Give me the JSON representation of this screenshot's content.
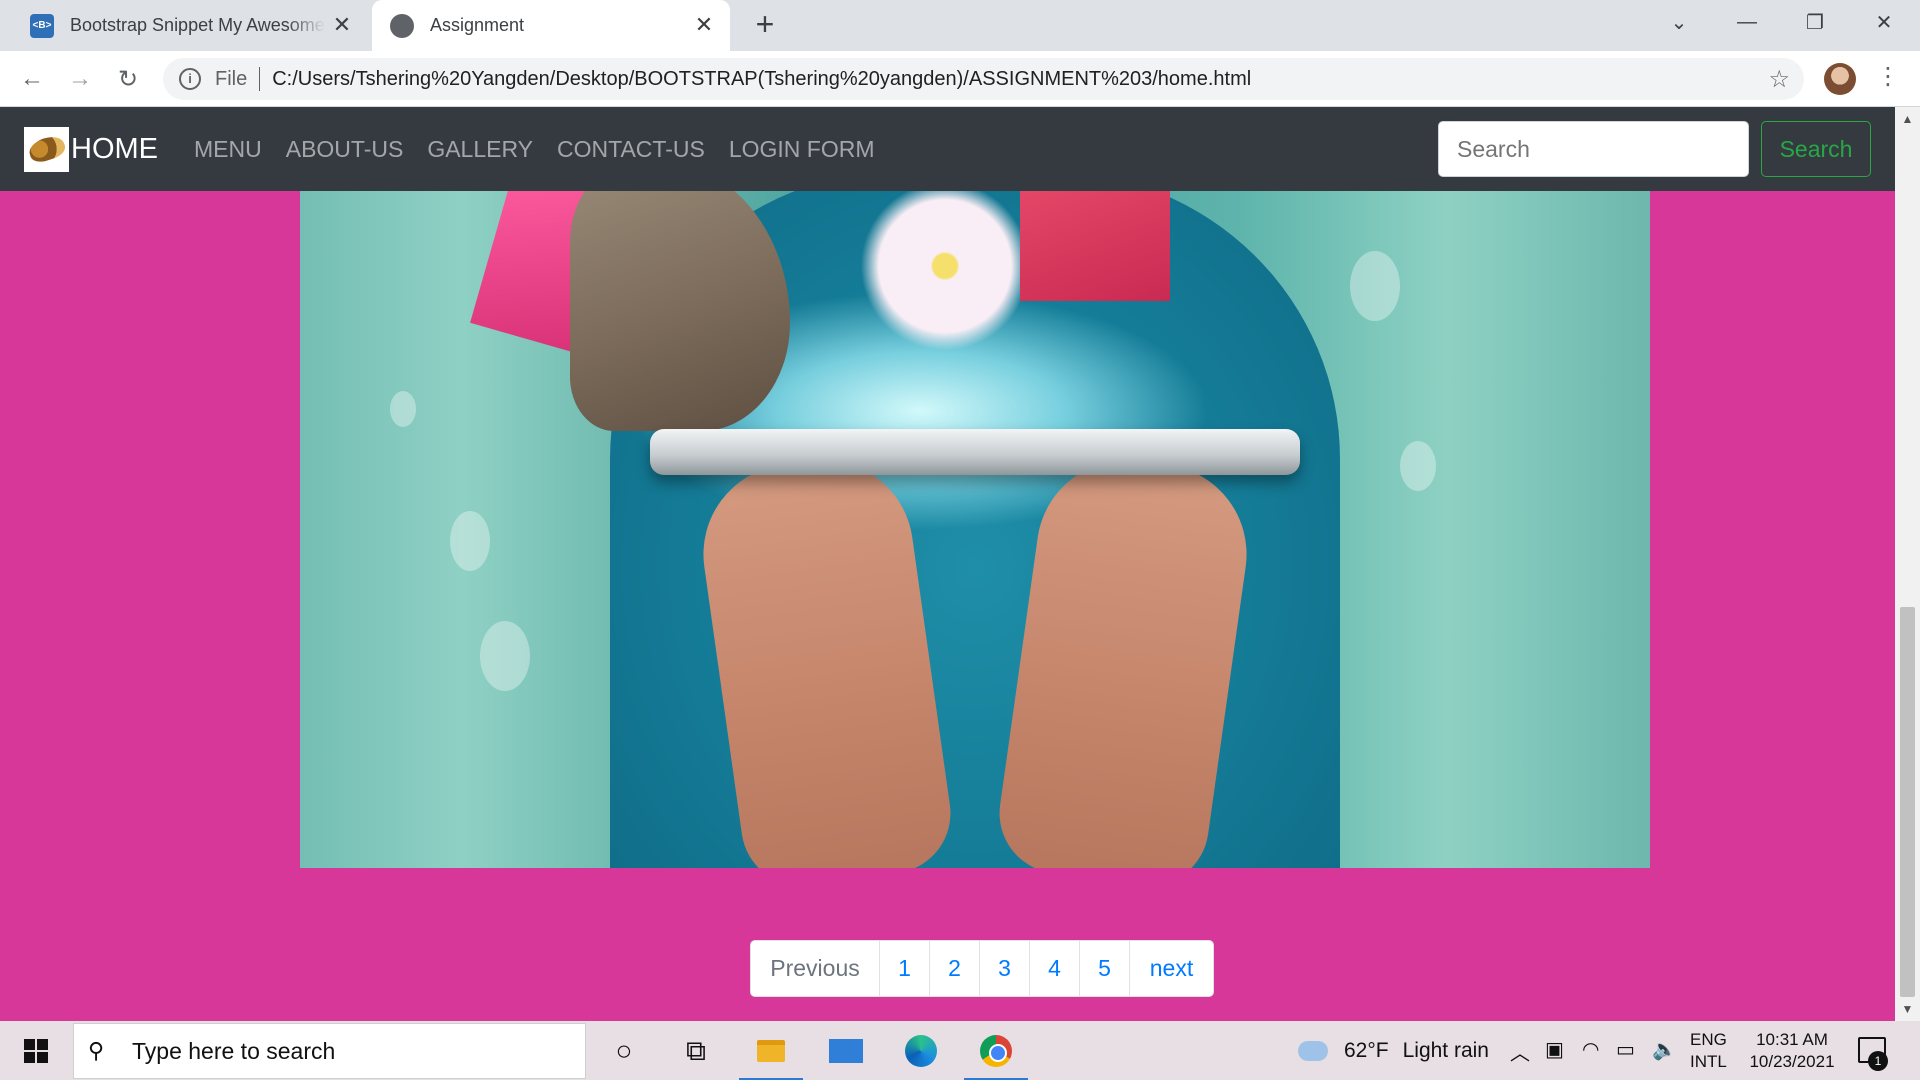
{
  "browser": {
    "tabs": [
      {
        "title": "Bootstrap Snippet My Awesome Navbar",
        "favicon": "bootstrap-icon"
      },
      {
        "title": "Assignment",
        "favicon": "globe-icon"
      }
    ],
    "address": {
      "scheme_label": "File",
      "url": "C:/Users/Tshering%20Yangden/Desktop/BOOTSTRAP(Tshering%20yangden)/ASSIGNMENT%203/home.html"
    }
  },
  "navbar": {
    "brand": "HOME",
    "links": [
      "MENU",
      "ABOUT-US",
      "GALLERY",
      "CONTACT-US",
      "LOGIN FORM"
    ],
    "search_placeholder": "Search",
    "search_button": "Search"
  },
  "hero": {
    "description_icon": "online-shopping-photo"
  },
  "pagination": {
    "previous": "Previous",
    "pages": [
      "1",
      "2",
      "3",
      "4",
      "5"
    ],
    "next": "next"
  },
  "taskbar": {
    "search_placeholder": "Type here to search",
    "weather_temp": "62°F",
    "weather_condition": "Light rain",
    "lang_line1": "ENG",
    "lang_line2": "INTL",
    "time": "10:31 AM",
    "date": "10/23/2021",
    "notification_count": "1"
  },
  "colors": {
    "page_background": "#d63799",
    "navbar_background": "#343a40",
    "search_button_accent": "#28a745",
    "link_blue": "#007bff"
  }
}
